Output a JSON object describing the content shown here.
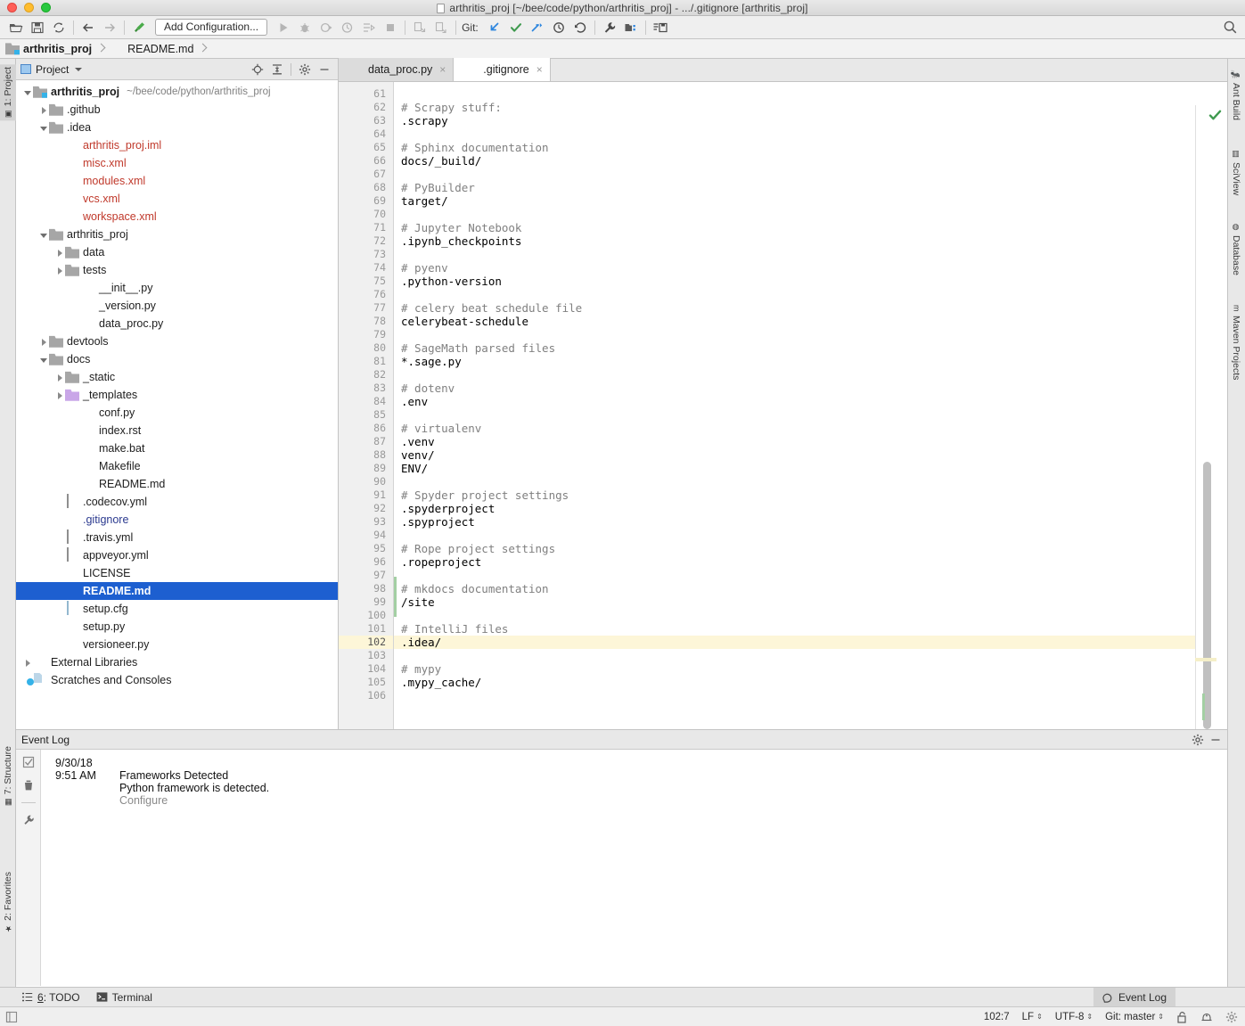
{
  "window": {
    "title": "arthritis_proj [~/bee/code/python/arthritis_proj] - .../.gitignore [arthritis_proj]"
  },
  "toolbar": {
    "icons": [
      "open-folder-icon",
      "save-icon",
      "sync-icon",
      "back-arrow-icon",
      "forward-arrow-icon",
      "build-hammer-icon"
    ],
    "run_config_label": "Add Configuration...",
    "git_label": "Git:",
    "run_icons": [
      "run-icon",
      "debug-icon",
      "run-coverage-icon",
      "profile-icon",
      "run-with-console-icon",
      "stop-icon"
    ],
    "extra_icons": [
      "deploy-icon",
      "upload-icon",
      "update-project-icon",
      "commit-icon",
      "push-icon",
      "history-icon",
      "rollback-icon",
      "settings-wrench-icon",
      "project-structure-icon",
      "save-all-icon"
    ],
    "search_icon": "search-icon"
  },
  "breadcrumb": {
    "items": [
      {
        "label": "arthritis_proj",
        "icon": "project-folder-icon"
      },
      {
        "label": "README.md",
        "icon": "markdown-file-icon"
      }
    ]
  },
  "left_strip": {
    "tabs": [
      {
        "label": "1: Project",
        "icon": "project-panel-icon",
        "selected": true
      },
      {
        "label": "7: Structure",
        "icon": "structure-icon",
        "selected": false
      },
      {
        "label": "2: Favorites",
        "icon": "star-icon",
        "selected": false
      }
    ]
  },
  "right_strip": {
    "tabs": [
      {
        "label": "Ant Build",
        "icon": "ant-icon"
      },
      {
        "label": "SciView",
        "icon": "sciview-icon"
      },
      {
        "label": "Database",
        "icon": "database-icon"
      },
      {
        "label": "Maven Projects",
        "icon": "maven-icon"
      }
    ]
  },
  "project_panel": {
    "title": "Project",
    "actions": [
      "locate-target-icon",
      "collapse-all-icon",
      "gear-icon",
      "minimize-icon"
    ],
    "tree": [
      {
        "label": "arthritis_proj",
        "path": "~/bee/code/python/arthritis_proj",
        "indent": 0,
        "arrow": "down",
        "icon": "project-root-folder-icon",
        "style": "root",
        "selected": false
      },
      {
        "label": ".github",
        "indent": 1,
        "arrow": "right",
        "icon": "folder-icon",
        "selected": false
      },
      {
        "label": ".idea",
        "indent": 1,
        "arrow": "down",
        "icon": "folder-icon",
        "selected": false
      },
      {
        "label": "arthritis_proj.iml",
        "indent": 2,
        "arrow": "none",
        "icon": "iml-file-icon",
        "style": "vcsfile",
        "selected": false
      },
      {
        "label": "misc.xml",
        "indent": 2,
        "arrow": "none",
        "icon": "xml-file-icon",
        "style": "vcsfile",
        "selected": false
      },
      {
        "label": "modules.xml",
        "indent": 2,
        "arrow": "none",
        "icon": "xml-file-icon",
        "style": "vcsfile",
        "selected": false
      },
      {
        "label": "vcs.xml",
        "indent": 2,
        "arrow": "none",
        "icon": "xml-file-icon",
        "style": "vcsfile",
        "selected": false
      },
      {
        "label": "workspace.xml",
        "indent": 2,
        "arrow": "none",
        "icon": "xml-file-icon",
        "style": "vcsfile",
        "selected": false
      },
      {
        "label": "arthritis_proj",
        "indent": 1,
        "arrow": "down",
        "icon": "folder-icon",
        "selected": false
      },
      {
        "label": "data",
        "indent": 2,
        "arrow": "right",
        "icon": "folder-icon",
        "selected": false
      },
      {
        "label": "tests",
        "indent": 2,
        "arrow": "right",
        "icon": "folder-icon",
        "selected": false
      },
      {
        "label": "__init__.py",
        "indent": 3,
        "arrow": "none",
        "icon": "python-file-icon",
        "selected": false
      },
      {
        "label": "_version.py",
        "indent": 3,
        "arrow": "none",
        "icon": "python-file-icon",
        "selected": false
      },
      {
        "label": "data_proc.py",
        "indent": 3,
        "arrow": "none",
        "icon": "python-file-icon",
        "selected": false
      },
      {
        "label": "devtools",
        "indent": 1,
        "arrow": "right",
        "icon": "folder-icon",
        "selected": false
      },
      {
        "label": "docs",
        "indent": 1,
        "arrow": "down",
        "icon": "folder-icon",
        "selected": false
      },
      {
        "label": "_static",
        "indent": 2,
        "arrow": "right",
        "icon": "folder-icon",
        "selected": false
      },
      {
        "label": "_templates",
        "indent": 2,
        "arrow": "right",
        "icon": "folder-purple-icon",
        "selected": false
      },
      {
        "label": "conf.py",
        "indent": 3,
        "arrow": "none",
        "icon": "python-file-icon",
        "selected": false
      },
      {
        "label": "index.rst",
        "indent": 3,
        "arrow": "none",
        "icon": "rst-file-icon",
        "selected": false
      },
      {
        "label": "make.bat",
        "indent": 3,
        "arrow": "none",
        "icon": "text-file-icon",
        "selected": false
      },
      {
        "label": "Makefile",
        "indent": 3,
        "arrow": "none",
        "icon": "text-file-icon",
        "selected": false
      },
      {
        "label": "README.md",
        "indent": 3,
        "arrow": "none",
        "icon": "markdown-file-icon",
        "selected": false
      },
      {
        "label": ".codecov.yml",
        "indent": 2,
        "arrow": "none",
        "icon": "yaml-file-icon",
        "selected": false
      },
      {
        "label": ".gitignore",
        "indent": 2,
        "arrow": "none",
        "icon": "text-file-icon",
        "style": "opened",
        "selected": false
      },
      {
        "label": ".travis.yml",
        "indent": 2,
        "arrow": "none",
        "icon": "yaml-file-icon",
        "selected": false
      },
      {
        "label": "appveyor.yml",
        "indent": 2,
        "arrow": "none",
        "icon": "yaml-file-icon",
        "selected": false
      },
      {
        "label": "LICENSE",
        "indent": 2,
        "arrow": "none",
        "icon": "text-file-icon",
        "selected": false
      },
      {
        "label": "README.md",
        "indent": 2,
        "arrow": "none",
        "icon": "markdown-file-icon",
        "selected": true
      },
      {
        "label": "setup.cfg",
        "indent": 2,
        "arrow": "none",
        "icon": "config-file-icon",
        "selected": false
      },
      {
        "label": "setup.py",
        "indent": 2,
        "arrow": "none",
        "icon": "python-file-icon",
        "selected": false
      },
      {
        "label": "versioneer.py",
        "indent": 2,
        "arrow": "none",
        "icon": "python-file-icon",
        "selected": false
      },
      {
        "label": "External Libraries",
        "indent": 0,
        "arrow": "right",
        "icon": "libraries-icon",
        "selected": false
      },
      {
        "label": "Scratches and Consoles",
        "indent": 0,
        "arrow": "none",
        "icon": "scratches-icon",
        "selected": false
      }
    ]
  },
  "editor": {
    "tabs": [
      {
        "label": "data_proc.py",
        "icon": "python-file-icon",
        "active": false,
        "close": "×"
      },
      {
        "label": ".gitignore",
        "icon": "text-file-icon",
        "active": true,
        "close": "×"
      }
    ],
    "first_line_number": 61,
    "inspection_status_icon": "ok-check-icon",
    "current_line": 102,
    "lines": [
      {
        "n": 61,
        "text": "",
        "kind": "plain"
      },
      {
        "n": 62,
        "text": "# Scrapy stuff:",
        "kind": "comment"
      },
      {
        "n": 63,
        "text": ".scrapy",
        "kind": "plain"
      },
      {
        "n": 64,
        "text": "",
        "kind": "plain"
      },
      {
        "n": 65,
        "text": "# Sphinx documentation",
        "kind": "comment"
      },
      {
        "n": 66,
        "text": "docs/_build/",
        "kind": "plain"
      },
      {
        "n": 67,
        "text": "",
        "kind": "plain"
      },
      {
        "n": 68,
        "text": "# PyBuilder",
        "kind": "comment"
      },
      {
        "n": 69,
        "text": "target/",
        "kind": "plain"
      },
      {
        "n": 70,
        "text": "",
        "kind": "plain"
      },
      {
        "n": 71,
        "text": "# Jupyter Notebook",
        "kind": "comment"
      },
      {
        "n": 72,
        "text": ".ipynb_checkpoints",
        "kind": "plain"
      },
      {
        "n": 73,
        "text": "",
        "kind": "plain"
      },
      {
        "n": 74,
        "text": "# pyenv",
        "kind": "comment"
      },
      {
        "n": 75,
        "text": ".python-version",
        "kind": "plain"
      },
      {
        "n": 76,
        "text": "",
        "kind": "plain"
      },
      {
        "n": 77,
        "text": "# celery beat schedule file",
        "kind": "comment"
      },
      {
        "n": 78,
        "text": "celerybeat-schedule",
        "kind": "plain"
      },
      {
        "n": 79,
        "text": "",
        "kind": "plain"
      },
      {
        "n": 80,
        "text": "# SageMath parsed files",
        "kind": "comment"
      },
      {
        "n": 81,
        "text": "*.sage.py",
        "kind": "plain"
      },
      {
        "n": 82,
        "text": "",
        "kind": "plain"
      },
      {
        "n": 83,
        "text": "# dotenv",
        "kind": "comment"
      },
      {
        "n": 84,
        "text": ".env",
        "kind": "plain"
      },
      {
        "n": 85,
        "text": "",
        "kind": "plain"
      },
      {
        "n": 86,
        "text": "# virtualenv",
        "kind": "comment"
      },
      {
        "n": 87,
        "text": ".venv",
        "kind": "plain"
      },
      {
        "n": 88,
        "text": "venv/",
        "kind": "plain"
      },
      {
        "n": 89,
        "text": "ENV/",
        "kind": "plain"
      },
      {
        "n": 90,
        "text": "",
        "kind": "plain"
      },
      {
        "n": 91,
        "text": "# Spyder project settings",
        "kind": "comment"
      },
      {
        "n": 92,
        "text": ".spyderproject",
        "kind": "plain"
      },
      {
        "n": 93,
        "text": ".spyproject",
        "kind": "plain"
      },
      {
        "n": 94,
        "text": "",
        "kind": "plain"
      },
      {
        "n": 95,
        "text": "# Rope project settings",
        "kind": "comment"
      },
      {
        "n": 96,
        "text": ".ropeproject",
        "kind": "plain"
      },
      {
        "n": 97,
        "text": "",
        "kind": "plain"
      },
      {
        "n": 98,
        "text": "# mkdocs documentation",
        "kind": "comment"
      },
      {
        "n": 99,
        "text": "/site",
        "kind": "plain"
      },
      {
        "n": 100,
        "text": "",
        "kind": "plain"
      },
      {
        "n": 101,
        "text": "# IntelliJ files",
        "kind": "comment"
      },
      {
        "n": 102,
        "text": ".idea/",
        "kind": "plain"
      },
      {
        "n": 103,
        "text": "",
        "kind": "plain"
      },
      {
        "n": 104,
        "text": "# mypy",
        "kind": "comment"
      },
      {
        "n": 105,
        "text": ".mypy_cache/",
        "kind": "plain"
      },
      {
        "n": 106,
        "text": "",
        "kind": "plain"
      }
    ]
  },
  "event_log": {
    "title": "Event Log",
    "actions": [
      "gear-icon",
      "minimize-icon"
    ],
    "side_icons": [
      "mark-read-icon",
      "trash-icon",
      "wrench-icon"
    ],
    "entries": [
      {
        "date": "9/30/18",
        "time": "9:51 AM",
        "title": "Frameworks Detected",
        "body": "Python framework is detected.",
        "link": "Configure"
      }
    ]
  },
  "bottom_bar": {
    "tabs": [
      {
        "label_prefix": "6",
        "label": ": TODO",
        "icon": "todo-list-icon"
      },
      {
        "label_prefix": "",
        "label": "Terminal",
        "icon": "terminal-icon"
      }
    ],
    "event_log_tab": {
      "label": "Event Log",
      "icon": "event-log-icon"
    }
  },
  "status_bar": {
    "left_icon": "toggle-tool-window-icon",
    "caret_position": "102:7",
    "line_separator": "LF",
    "encoding": "UTF-8",
    "branch": "Git: master",
    "icons": [
      "lock-open-icon",
      "inspection-hector-icon",
      "settings-gear-icon"
    ]
  },
  "colors": {
    "accent_selection": "#1d5fd0",
    "current_line": "#fdf6d8",
    "change_marker_green": "#a3cfa3",
    "comment_gray": "#808080",
    "vcs_file_red": "#c0392b",
    "opened_file_blue": "#2b3a8f",
    "git_check_green": "#3f9a4f"
  }
}
